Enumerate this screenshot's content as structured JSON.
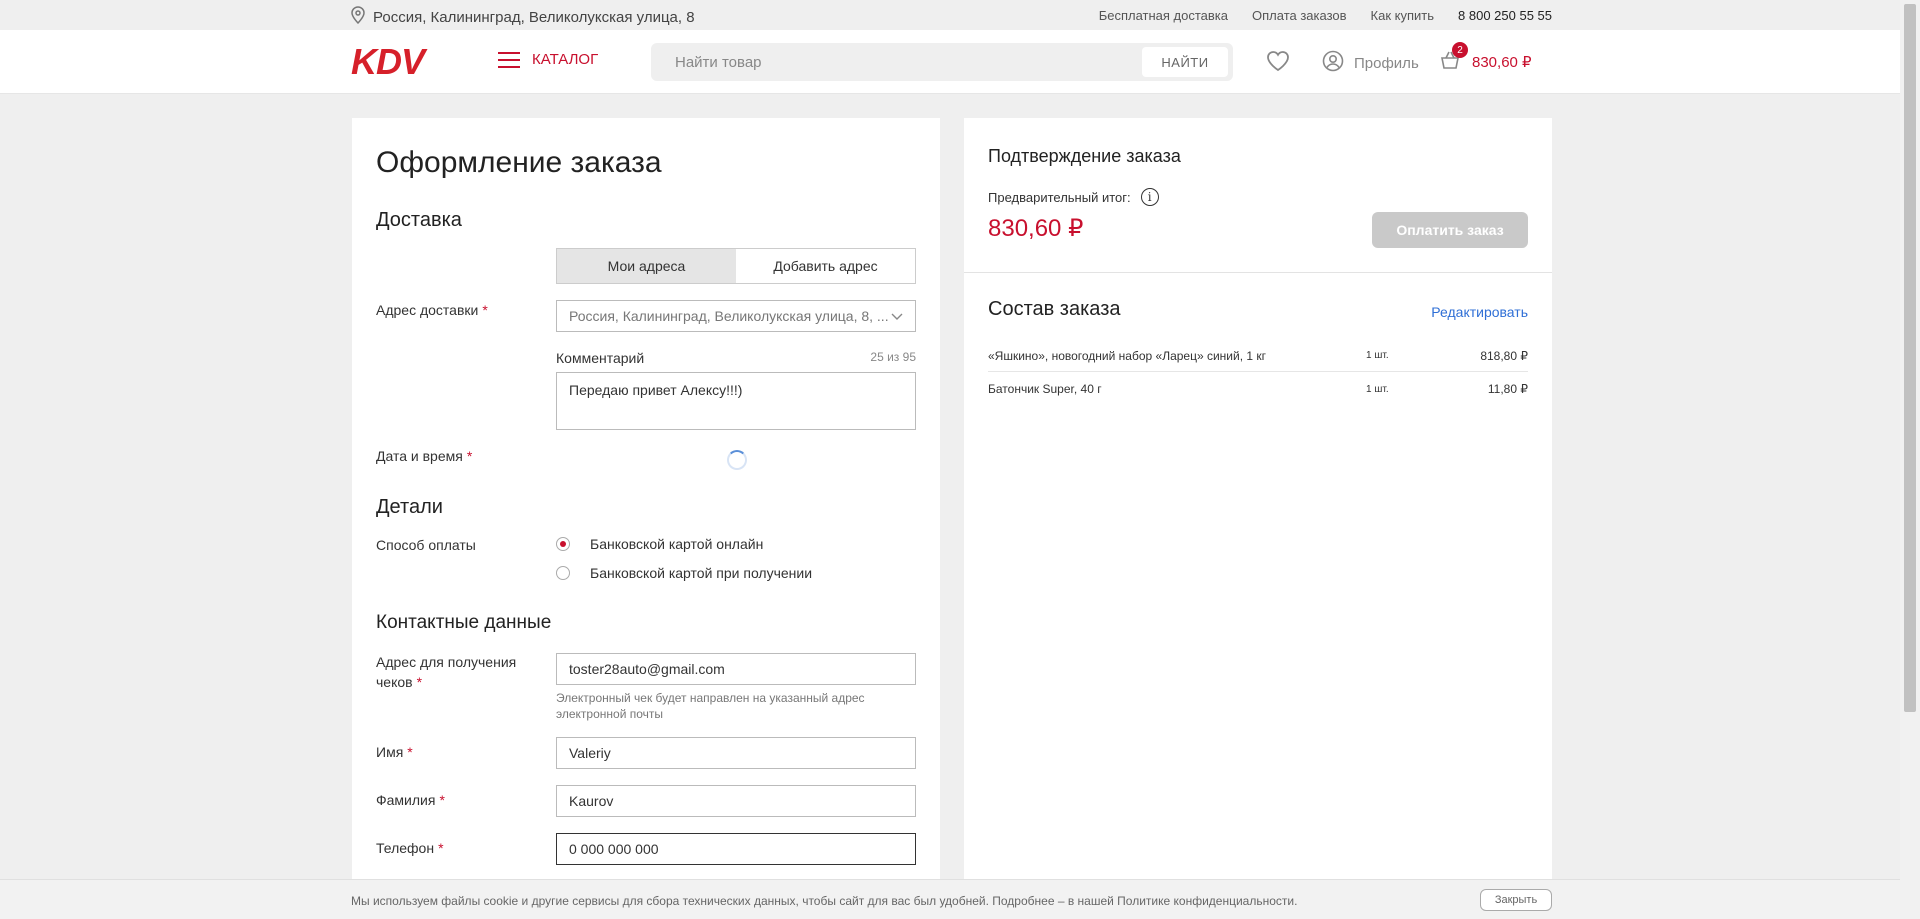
{
  "topbar": {
    "address": "Россия, Калининград, Великолукская улица, 8",
    "links": [
      "Бесплатная доставка",
      "Оплата заказов",
      "Как купить"
    ],
    "phone": "8 800 250 55 55"
  },
  "header": {
    "logo": "KDV",
    "catalog_label": "КАТАЛОГ",
    "search_placeholder": "Найти товар",
    "search_button": "НАЙТИ",
    "profile_label": "Профиль",
    "cart_count": "2",
    "cart_total": "830,60 ₽"
  },
  "checkout": {
    "title": "Оформление заказа",
    "delivery_title": "Доставка",
    "tab_my_addresses": "Мои адреса",
    "tab_add_address": "Добавить адрес",
    "address_label": "Адрес доставки",
    "address_value": "Россия, Калининград, Великолукская улица, 8, ...",
    "comment_label": "Комментарий",
    "comment_counter": "25 из 95",
    "comment_value": "Передаю привет Алексу!!!)",
    "datetime_label": "Дата и время",
    "details_title": "Детали",
    "payment_label": "Способ оплаты",
    "payment_option_online": "Банковской картой онлайн",
    "payment_option_on_delivery": "Банковской картой при получении",
    "contacts_title": "Контактные данные",
    "receipt_label": "Адрес для получения чеков",
    "receipt_value": "toster28auto@gmail.com",
    "receipt_hint": "Электронный чек будет направлен на указанный адрес электронной почты",
    "first_name_label": "Имя",
    "first_name_value": "Valeriy",
    "last_name_label": "Фамилия",
    "last_name_value": "Kaurov",
    "phone_label": "Телефон",
    "phone_value": "0 000 000 000",
    "required_mark": "*"
  },
  "summary": {
    "title": "Подтверждение заказа",
    "subtotal_label": "Предварительный итог:",
    "info_icon_glyph": "i",
    "total": "830,60 ₽",
    "pay_button": "Оплатить заказ",
    "composition_title": "Состав заказа",
    "edit_link": "Редактировать",
    "items": [
      {
        "name": "«Яшкино», новогодний набор «Ларец» синий, 1 кг",
        "qty": "1 шт.",
        "price": "818,80 ₽"
      },
      {
        "name": "Батончик Super, 40 г",
        "qty": "1 шт.",
        "price": "11,80 ₽"
      }
    ]
  },
  "cookie": {
    "text": "Мы используем файлы cookie и другие сервисы для сбора технических данных, чтобы сайт для вас был удобней. Подробнее – в нашей Политике конфиденциальности.",
    "close_button": "Закрыть"
  },
  "colors": {
    "brand": "#c8102e",
    "link": "#2f6fd6"
  },
  "icons": [
    "location-pin-icon",
    "burger-icon",
    "heart-icon",
    "user-icon",
    "cart-icon",
    "chevron-down-icon",
    "info-icon",
    "spinner-icon"
  ]
}
